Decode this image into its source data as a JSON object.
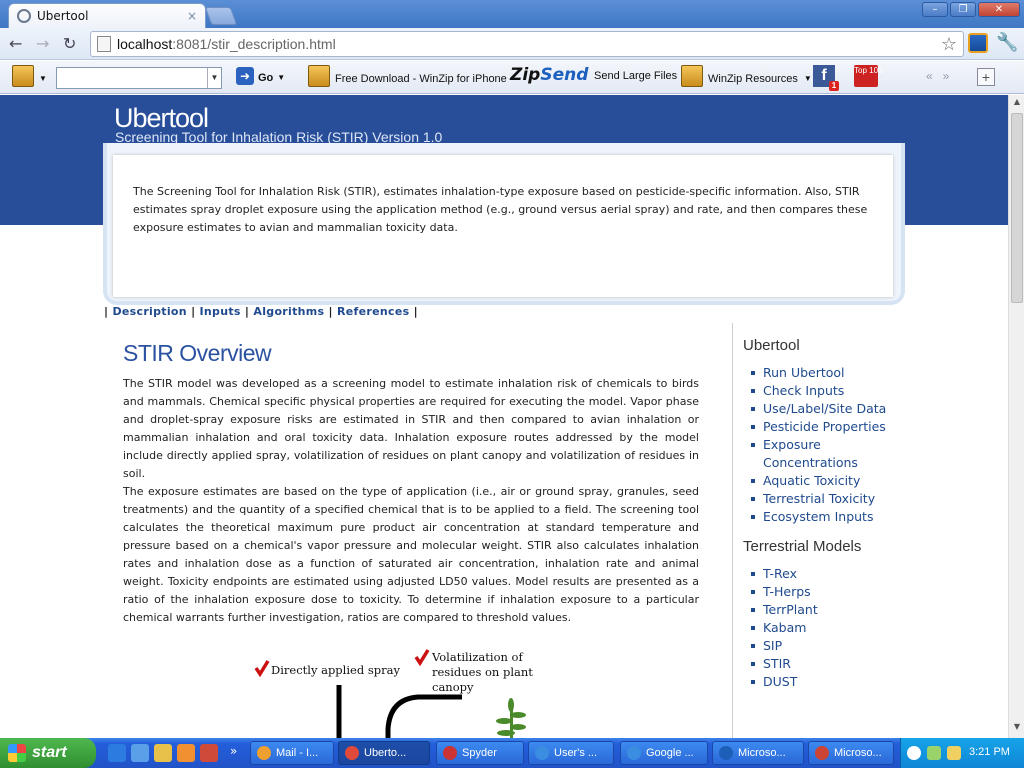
{
  "browser": {
    "tab_title": "Ubertool",
    "tab_close": "×",
    "url_host": "localhost",
    "url_path": ":8081/stir_description.html",
    "window_buttons": [
      "–",
      "❐",
      "✕"
    ]
  },
  "toolbar": {
    "go_label": "Go",
    "items": [
      "Free Download - WinZip for iPhone",
      "Send Large Files",
      "WinZip Resources"
    ],
    "zipsend_a": "Zip",
    "zipsend_b": "Send",
    "fb_badge": "1",
    "top100": "Top 100",
    "pager": "«»",
    "plus": "+"
  },
  "header": {
    "title": "Ubertool",
    "subtitle": "Screening Tool for Inhalation Risk (STIR) Version 1.0"
  },
  "intro": "The Screening Tool for Inhalation Risk (STIR), estimates inhalation-type exposure based on pesticide-specific information. Also, STIR estimates spray droplet exposure using the application method (e.g., ground versus aerial spray) and rate, and then compares these exposure estimates to avian and mammalian toxicity data.",
  "nav": {
    "sep": "|",
    "links": [
      "Description",
      "Inputs",
      "Algorithms",
      "References"
    ]
  },
  "overview": {
    "title": "STIR Overview",
    "p1": "The STIR model was developed as a screening model to estimate inhalation risk of chemicals to birds and mammals. Chemical specific physical properties are required for executing the model. Vapor phase and droplet-spray exposure risks are estimated in STIR and then compared to avian inhalation or mammalian inhalation and oral toxicity data. Inhalation exposure routes addressed by the model include directly applied spray, volatilization of residues on plant canopy and volatilization of residues in soil.",
    "p2": "The exposure estimates are based on the type of application (i.e., air or ground spray, granules, seed treatments) and the quantity of a specified chemical that is to be applied to a field. The screening tool calculates the theoretical maximum pure product air concentration at standard temperature and pressure based on a chemical's vapor pressure and molecular weight. STIR also calculates inhalation rates and inhalation dose as a function of saturated air concentration, inhalation rate and animal weight. Toxicity endpoints are estimated using adjusted LD50 values. Model results are presented as a ratio of the inhalation exposure dose to toxicity. To determine if inhalation exposure to a particular chemical warrants further investigation, ratios are compared to threshold values."
  },
  "diagram": {
    "label1": "Directly applied spray",
    "label2_l1": "Volatilization of",
    "label2_l2": "residues on plant",
    "label2_l3": "canopy"
  },
  "sidebar": {
    "ubertool_heading": "Ubertool",
    "ubertool_items": [
      "Run Ubertool",
      "Check Inputs",
      "Use/Label/Site Data",
      "Pesticide Properties",
      "Exposure Concentrations",
      "Aquatic Toxicity",
      "Terrestrial Toxicity",
      "Ecosystem Inputs"
    ],
    "models_heading": "Terrestrial Models",
    "model_items": [
      "T-Rex",
      "T-Herps",
      "TerrPlant",
      "Kabam",
      "SIP",
      "STIR",
      "DUST"
    ]
  },
  "taskbar": {
    "start": "start",
    "more": "»",
    "tasks": [
      {
        "label": "Mail - I...",
        "color": "#f0a030"
      },
      {
        "label": "Uberto...",
        "color": "#e04a3a"
      },
      {
        "label": "Spyder",
        "color": "#c33"
      },
      {
        "label": "User's ...",
        "color": "#3a8de0"
      },
      {
        "label": "Google ...",
        "color": "#3a8de0"
      },
      {
        "label": "Microso...",
        "color": "#1c5fb8"
      },
      {
        "label": "Microso...",
        "color": "#c43"
      }
    ],
    "clock": "3:21 PM"
  }
}
